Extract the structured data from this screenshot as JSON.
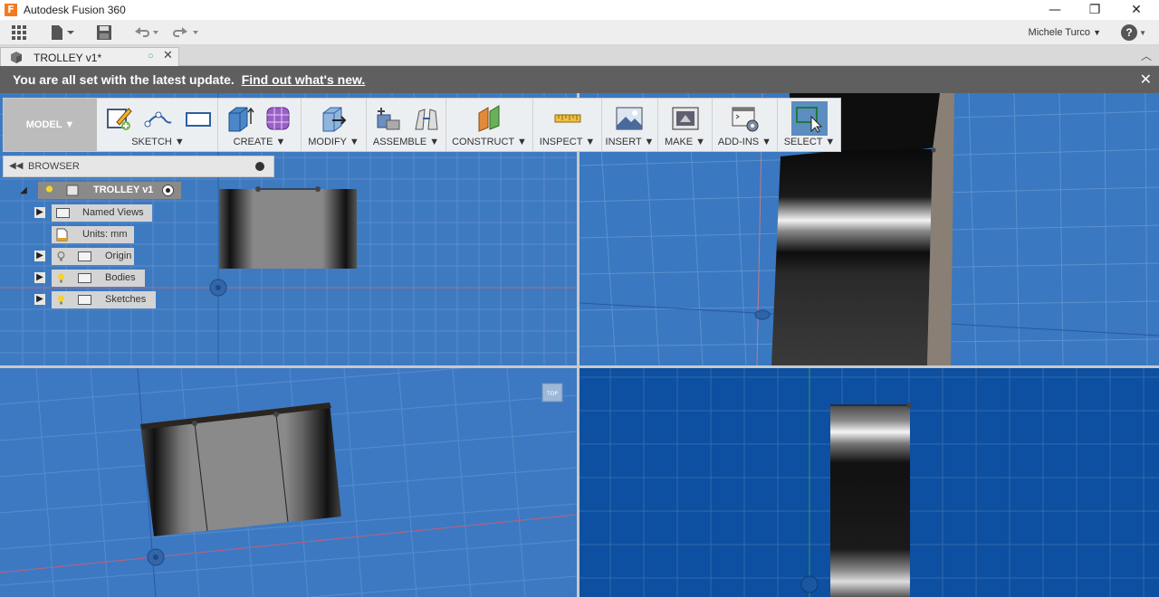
{
  "window": {
    "title": "Autodesk Fusion 360",
    "minimize": "—",
    "restore": "❐",
    "close": "✕"
  },
  "qat": {
    "user_name": "Michele Turco",
    "user_caret": "▼",
    "help": "?"
  },
  "tabs": {
    "doc_tab": "TROLLEY v1*"
  },
  "notification": {
    "text": "You are all set with the latest update.",
    "link": "Find out what's new."
  },
  "toolbar": {
    "model": "MODEL ▼",
    "groups": {
      "sketch": "SKETCH ▼",
      "create": "CREATE ▼",
      "modify": "MODIFY ▼",
      "assemble": "ASSEMBLE ▼",
      "construct": "CONSTRUCT ▼",
      "inspect": "INSPECT ▼",
      "insert": "INSERT ▼",
      "make": "MAKE ▼",
      "addins": "ADD-INS ▼",
      "select": "SELECT ▼"
    }
  },
  "browser": {
    "title": "BROWSER",
    "root": "TROLLEY v1",
    "items": {
      "named_views": "Named Views",
      "units": "Units: mm",
      "origin": "Origin",
      "bodies": "Bodies",
      "sketches": "Sketches"
    }
  },
  "viewcube": {
    "label": "TOP"
  },
  "colors": {
    "viewport_blue": "#3e7ac0",
    "viewport_dark_blue": "#0d4fa0",
    "select_active": "#5b8dc0",
    "notification_bg": "#5f5f5f"
  }
}
